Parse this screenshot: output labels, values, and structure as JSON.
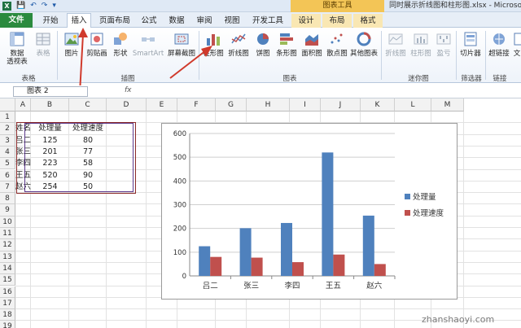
{
  "window": {
    "title": "同时展示折线图和柱形图.xlsx - Microsoft",
    "context_tools_label": "图表工具"
  },
  "tabs": [
    {
      "label": "文件"
    },
    {
      "label": "开始"
    },
    {
      "label": "插入"
    },
    {
      "label": "页面布局"
    },
    {
      "label": "公式"
    },
    {
      "label": "数据"
    },
    {
      "label": "审阅"
    },
    {
      "label": "视图"
    },
    {
      "label": "开发工具"
    },
    {
      "label": "设计"
    },
    {
      "label": "布局"
    },
    {
      "label": "格式"
    }
  ],
  "ribbon": {
    "buttons": [
      {
        "label": "数据",
        "label2": "透视表",
        "icon": "pivot-table-icon"
      },
      {
        "label": "表格",
        "icon": "table-icon"
      },
      {
        "label": "图片",
        "icon": "picture-icon"
      },
      {
        "label": "剪贴画",
        "icon": "clipart-icon"
      },
      {
        "label": "形状",
        "icon": "shapes-icon"
      },
      {
        "label": "SmartArt",
        "icon": "smartart-icon"
      },
      {
        "label": "屏幕截图",
        "icon": "screenshot-icon"
      },
      {
        "label": "柱形图",
        "icon": "column-chart-icon"
      },
      {
        "label": "折线图",
        "icon": "line-chart-icon"
      },
      {
        "label": "饼图",
        "icon": "pie-chart-icon"
      },
      {
        "label": "条形图",
        "icon": "bar-chart-icon"
      },
      {
        "label": "面积图",
        "icon": "area-chart-icon"
      },
      {
        "label": "散点图",
        "icon": "scatter-chart-icon"
      },
      {
        "label": "其他图表",
        "icon": "other-charts-icon"
      },
      {
        "label": "折线图",
        "icon": "sparkline-line-icon"
      },
      {
        "label": "柱形图",
        "icon": "sparkline-column-icon"
      },
      {
        "label": "盈亏",
        "icon": "sparkline-winloss-icon"
      },
      {
        "label": "切片器",
        "icon": "slicer-icon"
      },
      {
        "label": "超链接",
        "icon": "hyperlink-icon"
      },
      {
        "label": "文",
        "icon": "text-icon"
      }
    ],
    "groups": [
      {
        "label": "表格"
      },
      {
        "label": "插图"
      },
      {
        "label": "图表"
      },
      {
        "label": "迷你图"
      },
      {
        "label": "筛选器"
      },
      {
        "label": "链接"
      }
    ]
  },
  "formula_bar": {
    "name_box": "图表 2",
    "fx": "fx"
  },
  "sheet": {
    "columns": [
      "A",
      "B",
      "C",
      "D",
      "E",
      "F",
      "G",
      "H",
      "I",
      "J",
      "K",
      "L",
      "M"
    ],
    "rows": [
      "1",
      "2",
      "3",
      "4",
      "5",
      "6",
      "7",
      "8",
      "9",
      "10",
      "11",
      "12",
      "13",
      "14",
      "15",
      "16",
      "17",
      "18",
      "19"
    ],
    "table": {
      "headers": [
        "姓名",
        "处理量",
        "处理速度"
      ],
      "rows": [
        [
          "吕二",
          "125",
          "80"
        ],
        [
          "张三",
          "201",
          "77"
        ],
        [
          "李四",
          "223",
          "58"
        ],
        [
          "王五",
          "520",
          "90"
        ],
        [
          "赵六",
          "254",
          "50"
        ]
      ]
    }
  },
  "chart_data": {
    "type": "bar",
    "categories": [
      "吕二",
      "张三",
      "李四",
      "王五",
      "赵六"
    ],
    "series": [
      {
        "name": "处理量",
        "values": [
          125,
          201,
          223,
          520,
          254
        ],
        "color": "#4f81bd"
      },
      {
        "name": "处理速度",
        "values": [
          80,
          77,
          58,
          90,
          50
        ],
        "color": "#c0504d"
      }
    ],
    "ylim": [
      0,
      600
    ],
    "yticks": [
      "0",
      "100",
      "200",
      "300",
      "400",
      "500",
      "600"
    ],
    "grid": true,
    "legend": "right"
  },
  "watermark": "zhanshaoyi.com"
}
